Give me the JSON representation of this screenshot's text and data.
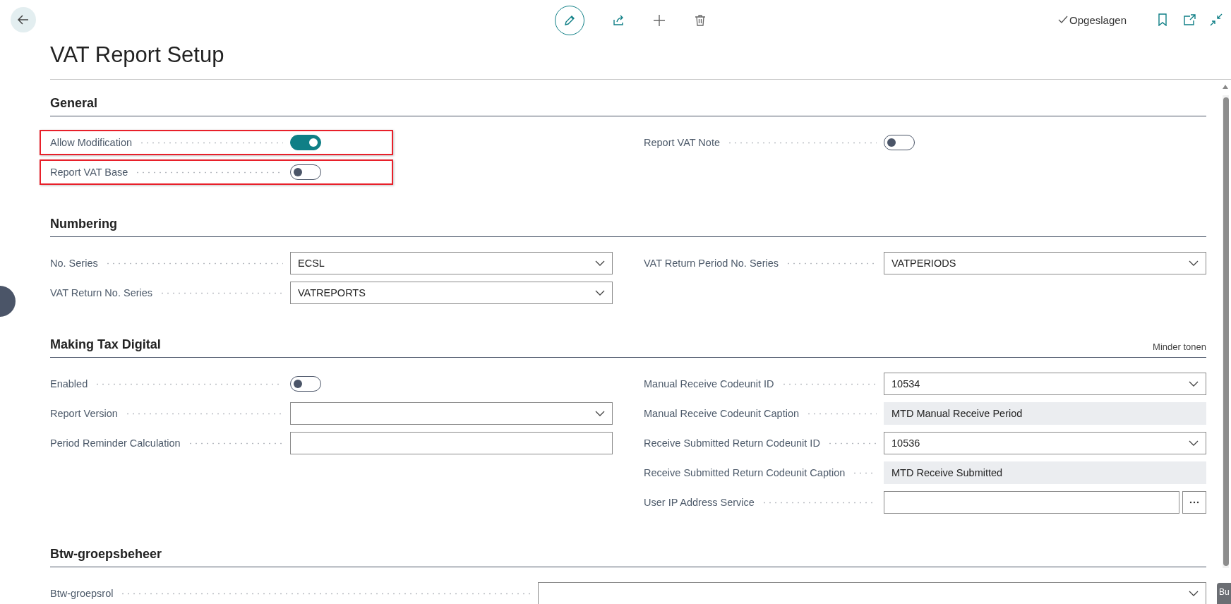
{
  "toolbar": {
    "status": "Opgeslagen"
  },
  "title": "VAT Report Setup",
  "sections": [
    {
      "title": "General",
      "wide": false,
      "columns": [
        [
          {
            "label": "Allow Modification",
            "kind": "toggle",
            "on": true,
            "highlighted": true
          },
          {
            "label": "Report VAT Base",
            "kind": "toggle",
            "on": false,
            "highlighted": true
          }
        ],
        [
          {
            "label": "Report VAT Note",
            "kind": "toggle",
            "on": false,
            "highlighted": false
          }
        ]
      ]
    },
    {
      "title": "Numbering",
      "wide": false,
      "columns": [
        [
          {
            "label": "No. Series",
            "kind": "select",
            "value": "ECSL"
          },
          {
            "label": "VAT Return No. Series",
            "kind": "select",
            "value": "VATREPORTS"
          }
        ],
        [
          {
            "label": "VAT Return Period No. Series",
            "kind": "select",
            "value": "VATPERIODS"
          }
        ]
      ]
    },
    {
      "title": "Making Tax Digital",
      "action": "Minder tonen",
      "wide": false,
      "columns": [
        [
          {
            "label": "Enabled",
            "kind": "toggle",
            "on": false,
            "highlighted": false
          },
          {
            "label": "Report Version",
            "kind": "select"
          },
          {
            "label": "Period Reminder Calculation",
            "kind": "input"
          }
        ],
        [
          {
            "label": "Manual Receive Codeunit ID",
            "kind": "number-select",
            "value": "10534"
          },
          {
            "label": "Manual Receive Codeunit Caption",
            "kind": "readonly",
            "value": "MTD Manual Receive Period"
          },
          {
            "label": "Receive Submitted Return Codeunit ID",
            "kind": "number-select",
            "value": "10536"
          },
          {
            "label": "Receive Submitted Return Codeunit Caption",
            "kind": "readonly",
            "value": "MTD Receive Submitted"
          },
          {
            "label": "User IP Address Service",
            "kind": "lookup"
          }
        ]
      ]
    },
    {
      "title": "Btw-groepsbeheer",
      "wide": true,
      "columns": [
        [
          {
            "label": "Btw-groepsrol",
            "kind": "select"
          }
        ]
      ]
    }
  ],
  "corner_badge": "Bu"
}
